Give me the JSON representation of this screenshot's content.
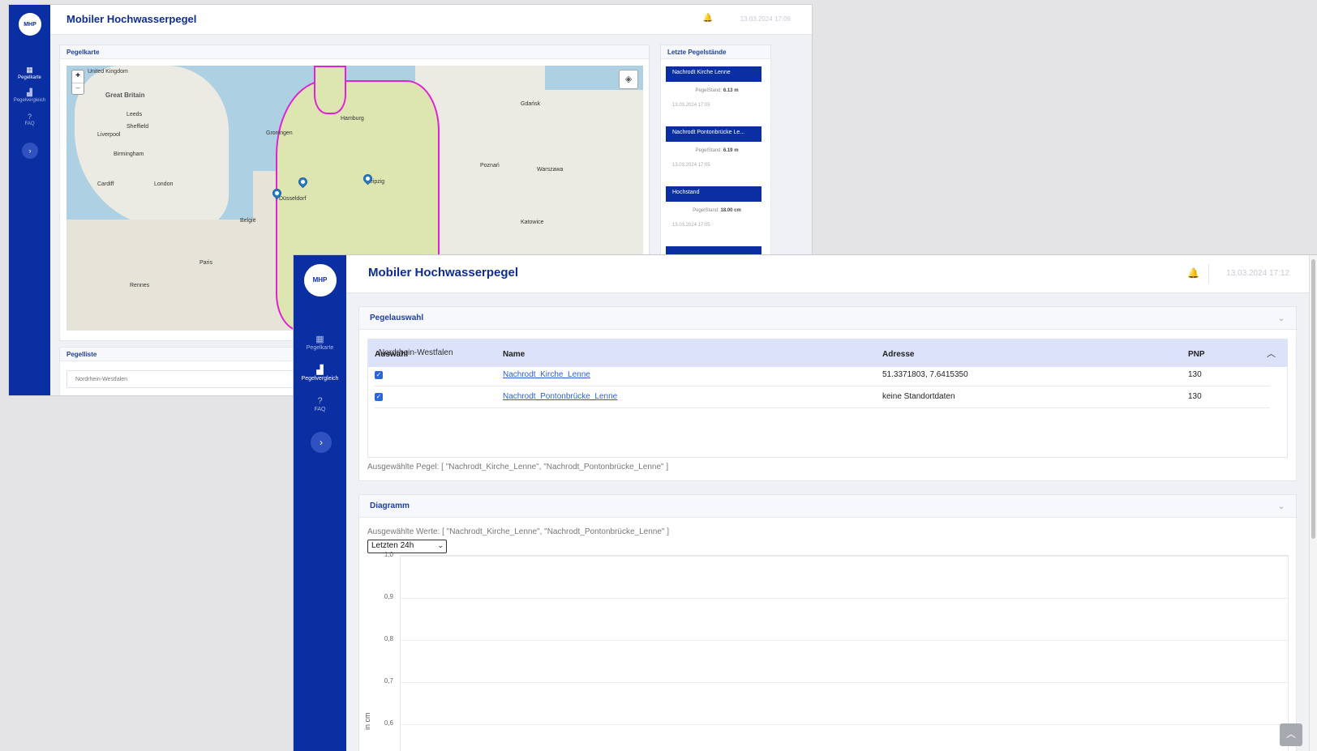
{
  "app": {
    "title": "Mobiler Hochwasserpegel",
    "logo_text": "MHP",
    "brand_color": "#0a2fa2",
    "accent_color": "#e021d4"
  },
  "back_window": {
    "timestamp": "13.03.2024 17:09",
    "sidebar": [
      {
        "label": "Pegelkarte",
        "icon": "map-icon"
      },
      {
        "label": "Pegelvergleich",
        "icon": "chart-icon"
      },
      {
        "label": "FAQ",
        "icon": "question-icon"
      }
    ],
    "map_card_title": "Pegelkarte",
    "map_labels": {
      "great_britain": "Great Britain",
      "kingdom": "United Kingdom",
      "leeds": "Leeds",
      "sheffield": "Sheffield",
      "liverpool": "Liverpool",
      "birmingham": "Birmingham",
      "london": "London",
      "cardiff": "Cardiff",
      "dusseldorf": "Düsseldorf",
      "belgie": "België",
      "paris": "Paris",
      "poznan": "Poznań",
      "warszawa": "Warszawa",
      "leipzig": "Leipzig",
      "hamburg": "Hamburg",
      "groningen": "Groningen",
      "katowice": "Katowice",
      "gdansk": "Gdańsk",
      "rennes": "Rennes"
    },
    "list_card_title": "Pegelliste",
    "list_select_value": "Nordrhein-Westfalen",
    "latest": {
      "title": "Letzte Pegelstände",
      "items": [
        {
          "name": "Nachrodt Kirche Lenne",
          "label": "PegelStand:",
          "value": "6.13 m",
          "date": "13.03.2024 17:05"
        },
        {
          "name": "Nachrodt Pontonbrücke Le...",
          "label": "PegelStand:",
          "value": "6.19 m",
          "date": "13.03.2024 17:05"
        },
        {
          "name": "Hochstand",
          "label": "PegelStand:",
          "value": "18.00 cm",
          "date": "13.03.2024 17:05"
        }
      ]
    }
  },
  "front_window": {
    "timestamp": "13.03.2024 17:12",
    "sidebar": [
      {
        "label": "Pegelkarte",
        "icon": "map-icon"
      },
      {
        "label": "Pegelvergleich",
        "icon": "chart-icon"
      },
      {
        "label": "FAQ",
        "icon": "question-icon"
      }
    ],
    "selection": {
      "title": "Pegelauswahl",
      "region": "Nordrhein-Westfalen",
      "columns": [
        "Auswahl",
        "Name",
        "Adresse",
        "PNP"
      ],
      "rows": [
        {
          "name": "Nachrodt_Kirche_Lenne",
          "address": "51.3371803, 7.6415350",
          "pnp": "130"
        },
        {
          "name": "Nachrodt_Pontonbrücke_Lenne",
          "address": "keine Standortdaten",
          "pnp": "130"
        }
      ],
      "selected_text": "Ausgewählte Pegel: [ \"Nachrodt_Kirche_Lenne\", \"Nachrodt_Pontonbrücke_Lenne\" ]"
    },
    "diagram": {
      "title": "Diagramm",
      "selected_values_text": "Ausgewählte Werte: [ \"Nachrodt_Kirche_Lenne\", \"Nachrodt_Pontonbrücke_Lenne\" ]",
      "range_select": "Letzten 24h"
    }
  },
  "chart_data": {
    "type": "line",
    "title": "",
    "ylabel": "in cm",
    "yticks": [
      "1,0",
      "0,9",
      "0,8",
      "0,7",
      "0,6"
    ],
    "ylim": [
      0.5,
      1.0
    ],
    "grid": true,
    "series": []
  }
}
